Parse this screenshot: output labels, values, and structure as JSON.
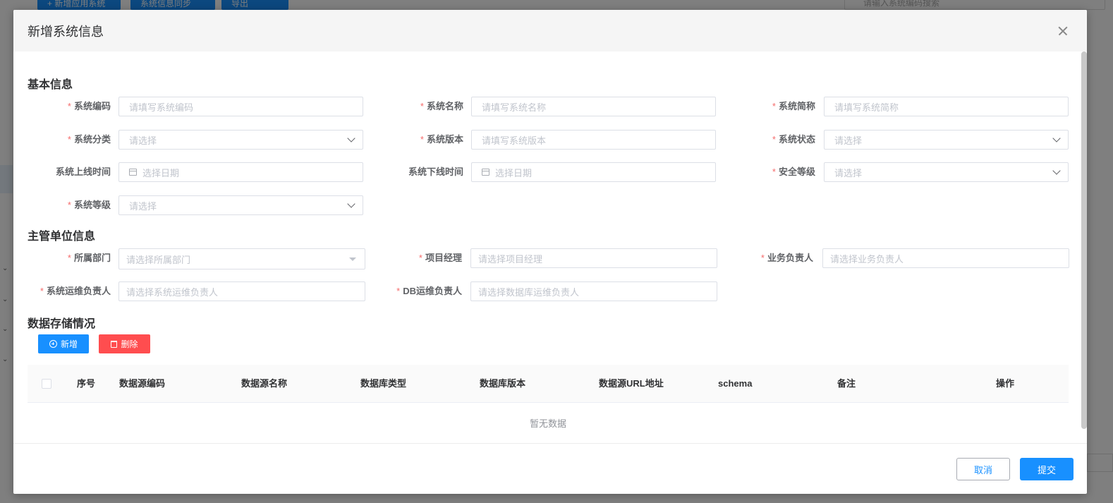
{
  "background": {
    "buttons": [
      "+ 新增应用系统",
      "系统信息同步",
      "导出"
    ],
    "search_placeholder": "请输入系统编码搜索"
  },
  "dialog": {
    "title": "新增系统信息",
    "sections": {
      "basic": "基本信息",
      "org": "主管单位信息",
      "storage": "数据存储情况"
    },
    "fields": {
      "sys_code": {
        "label": "系统编码",
        "placeholder": "请填写系统编码"
      },
      "sys_name": {
        "label": "系统名称",
        "placeholder": "请填写系统名称"
      },
      "sys_abbr": {
        "label": "系统简称",
        "placeholder": "请填写系统简称"
      },
      "sys_category": {
        "label": "系统分类",
        "placeholder": "请选择"
      },
      "sys_version": {
        "label": "系统版本",
        "placeholder": "请填写系统版本"
      },
      "sys_status": {
        "label": "系统状态",
        "placeholder": "请选择"
      },
      "online_time": {
        "label": "系统上线时间",
        "placeholder": "选择日期"
      },
      "offline_time": {
        "label": "系统下线时间",
        "placeholder": "选择日期"
      },
      "security_level": {
        "label": "安全等级",
        "placeholder": "请选择"
      },
      "sys_level": {
        "label": "系统等级",
        "placeholder": "请选择"
      },
      "department": {
        "label": "所属部门",
        "placeholder": "请选择所属部门"
      },
      "project_manager": {
        "label": "项目经理",
        "placeholder": "请选择项目经理"
      },
      "business_owner": {
        "label": "业务负责人",
        "placeholder": "请选择业务负责人"
      },
      "ops_owner": {
        "label": "系统运维负责人",
        "placeholder": "请选择系统运维负责人"
      },
      "db_owner": {
        "label": "DB运维负责人",
        "placeholder": "请选择数据库运维负责人"
      }
    },
    "toolbar": {
      "add": "新增",
      "delete": "删除"
    },
    "table": {
      "columns": [
        "序号",
        "数据源编码",
        "数据源名称",
        "数据库类型",
        "数据库版本",
        "数据源URL地址",
        "schema",
        "备注",
        "操作"
      ],
      "empty_text": "暂无数据"
    },
    "footer": {
      "cancel": "取消",
      "submit": "提交"
    }
  },
  "colors": {
    "primary": "#1890ff",
    "danger": "#ff4d4f",
    "required": "#f56c6c"
  }
}
